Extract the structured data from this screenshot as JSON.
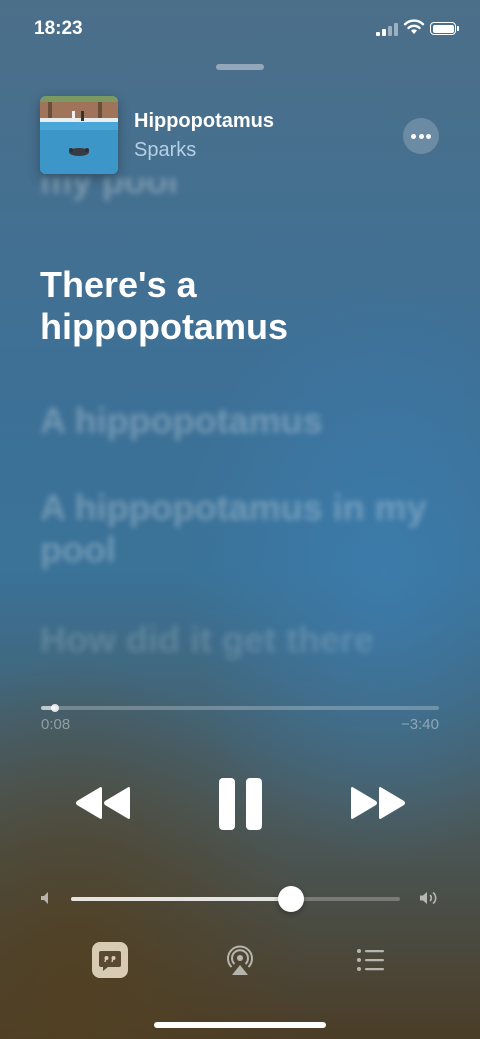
{
  "status_bar": {
    "time": "18:23"
  },
  "now_playing": {
    "song": "Hippopotamus",
    "artist": "Sparks"
  },
  "lyrics": {
    "previous": "my pool",
    "current": "There's a hippopotamus",
    "upcoming": [
      "A hippopotamus",
      "A hippopotamus in my pool",
      "How did it get there"
    ]
  },
  "playback": {
    "elapsed": "0:08",
    "remaining": "−3:40",
    "progress_fraction": 0.035
  },
  "volume": {
    "level_fraction": 0.67
  },
  "colors": {
    "accent": "#ffffff",
    "lyrics_button_bg": "#d8cbb4"
  },
  "icons": {
    "controls": [
      "rewind-icon",
      "pause-icon",
      "fast-forward-icon"
    ],
    "bottom": [
      "lyrics-icon",
      "airplay-icon",
      "queue-icon"
    ]
  }
}
